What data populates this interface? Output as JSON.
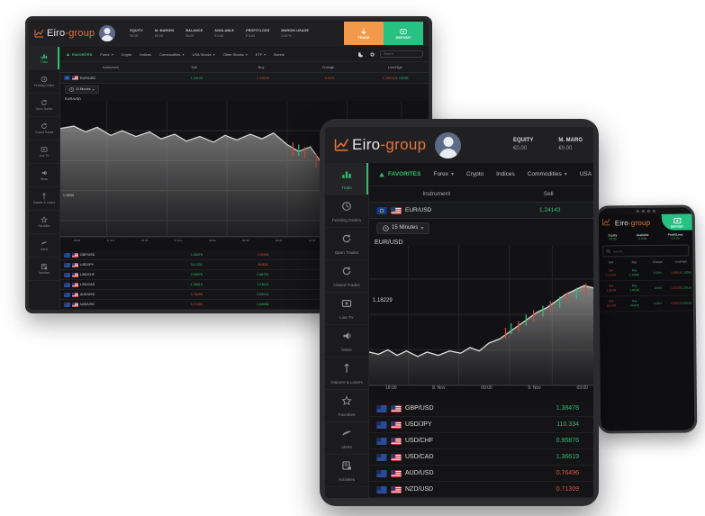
{
  "brand": {
    "name_a": "Eiro",
    "name_b": "-group",
    "logo_icon": "line-chart-icon"
  },
  "desktop": {
    "stats": [
      {
        "label": "EQUITY",
        "value": "€0.00"
      },
      {
        "label": "M. MARGIN",
        "value": "€0.00"
      },
      {
        "label": "BALANCE",
        "value": "€0.00"
      },
      {
        "label": "AVAILABLE",
        "value": "€ 0.00"
      },
      {
        "label": "PROFIT/LOSS",
        "value": "€ 0.00"
      },
      {
        "label": "MARGIN USAGE",
        "value": "0.00 %"
      }
    ],
    "buttons": {
      "trade": "TRADE",
      "deposit": "DEPOSIT"
    },
    "sidebar": [
      {
        "label": "Trade",
        "icon": "chart-icon",
        "active": true
      },
      {
        "label": "Pending Orders",
        "icon": "clock-icon",
        "active": false
      },
      {
        "label": "Open Trades",
        "icon": "refresh-icon",
        "active": false
      },
      {
        "label": "Closed Trades",
        "icon": "refresh-icon",
        "active": false
      },
      {
        "label": "Live TV",
        "icon": "tv-icon",
        "active": false
      },
      {
        "label": "News",
        "icon": "megaphone-icon",
        "active": false
      },
      {
        "label": "Gainers & Losers",
        "icon": "arrows-icon",
        "active": false
      },
      {
        "label": "Favorites",
        "icon": "star-icon",
        "active": false
      },
      {
        "label": "Alerts",
        "icon": "bell-icon",
        "active": false
      },
      {
        "label": "Activities",
        "icon": "list-icon",
        "active": false
      }
    ],
    "nav": [
      {
        "label": "FAVORITES",
        "caret": false,
        "fav": true
      },
      {
        "label": "Forex",
        "caret": true,
        "fav": false
      },
      {
        "label": "Crypto",
        "caret": false,
        "fav": false
      },
      {
        "label": "Indices",
        "caret": false,
        "fav": false
      },
      {
        "label": "Commodities",
        "caret": true,
        "fav": false
      },
      {
        "label": "USA Stocks",
        "caret": true,
        "fav": false
      },
      {
        "label": "Other Stocks",
        "caret": true,
        "fav": false
      },
      {
        "label": "ETF",
        "caret": true,
        "fav": false
      },
      {
        "label": "Bonds",
        "caret": false,
        "fav": false
      }
    ],
    "search": {
      "placeholder": "Search"
    },
    "table": {
      "headers": [
        "Instrument",
        "Sell",
        "Buy",
        "Change",
        "Low/High"
      ],
      "selected": {
        "name": "EUR/USD",
        "sell": "1.24143",
        "buy": "1.13239",
        "change": "-0.01%",
        "low": "1.18014",
        "high": "1.19296"
      },
      "timeframe": "15 Minutes",
      "symbol_label": "EUR/USD",
      "price_tag": "1.18039"
    },
    "chart_axis": [
      "18:00",
      "8. Nov",
      "09:00",
      "9. Nov",
      "03:00",
      "06:00",
      "09:00",
      "12:00",
      "15:00",
      "18:00",
      "21:00"
    ],
    "list": [
      {
        "name": "GBP/USD",
        "sell": "1.38478",
        "buy": "1.25196",
        "change": "0.13%",
        "sell_up": true,
        "buy_up": false,
        "chg_up": true
      },
      {
        "name": "USD/JPY",
        "sell": "110.334",
        "buy": "99.828",
        "change": "-0.03%",
        "sell_up": true,
        "buy_up": false,
        "chg_up": false
      },
      {
        "name": "USD/CHF",
        "sell": "0.95876",
        "buy": "0.86751",
        "change": "0.04%",
        "sell_up": true,
        "buy_up": true,
        "chg_up": true
      },
      {
        "name": "USD/CAD",
        "sell": "1.36619",
        "buy": "1.23613",
        "change": "0.04%",
        "sell_up": true,
        "buy_up": true,
        "chg_up": true
      },
      {
        "name": "AUD/USD",
        "sell": "0.76496",
        "buy": "0.69214",
        "change": "0.11%",
        "sell_up": false,
        "buy_up": true,
        "chg_up": true
      },
      {
        "name": "NZD/USD",
        "sell": "0.71309",
        "buy": "0.64896",
        "change": "0.11%",
        "sell_up": false,
        "buy_up": true,
        "chg_up": true
      }
    ],
    "icons": {
      "dark_mode": "moon-icon",
      "settings": "gear-icon",
      "search": "search-icon"
    }
  },
  "tablet": {
    "stats": [
      {
        "label": "EQUITY",
        "value": "€0.00"
      },
      {
        "label": "M. MARG",
        "value": "€0.00"
      }
    ],
    "sidebar": [
      {
        "label": "Trade",
        "icon": "chart-icon",
        "active": true
      },
      {
        "label": "Pending Orders",
        "icon": "clock-icon",
        "active": false
      },
      {
        "label": "Open Trades",
        "icon": "refresh-icon",
        "active": false
      },
      {
        "label": "Closed Trades",
        "icon": "refresh-icon",
        "active": false
      },
      {
        "label": "Live TV",
        "icon": "tv-icon",
        "active": false
      },
      {
        "label": "News",
        "icon": "megaphone-icon",
        "active": false
      },
      {
        "label": "Gainers & Losers",
        "icon": "arrows-icon",
        "active": false
      },
      {
        "label": "Favorites",
        "icon": "star-icon",
        "active": false
      },
      {
        "label": "Alerts",
        "icon": "bell-icon",
        "active": false
      },
      {
        "label": "Activities",
        "icon": "list-icon",
        "active": false
      }
    ],
    "nav": [
      {
        "label": "FAVORITES",
        "caret": false,
        "fav": true
      },
      {
        "label": "Forex",
        "caret": true,
        "fav": false
      },
      {
        "label": "Crypto",
        "caret": false,
        "fav": false
      },
      {
        "label": "Indices",
        "caret": false,
        "fav": false
      },
      {
        "label": "Commodities",
        "caret": true,
        "fav": false
      },
      {
        "label": "USA Stock",
        "caret": false,
        "fav": false
      }
    ],
    "table": {
      "headers": [
        "Instrument",
        "Sell"
      ],
      "selected": {
        "name": "EUR/USD",
        "sell": "1.24143"
      },
      "timeframe": "15 Minutes",
      "symbol_label": "EUR/USD",
      "price_tag": "1.18229"
    },
    "chart_axis": [
      "18:00",
      "8. Nov",
      "09:00",
      "9. Nov",
      "03:00"
    ],
    "list": [
      {
        "name": "GBP/USD",
        "value": "1.38478",
        "up": true
      },
      {
        "name": "USD/JPY",
        "value": "110.334",
        "up": true
      },
      {
        "name": "USD/CHF",
        "value": "0.95876",
        "up": true
      },
      {
        "name": "USD/CAD",
        "value": "1.36619",
        "up": true
      },
      {
        "name": "AUD/USD",
        "value": "0.76496",
        "up": false
      },
      {
        "name": "NZD/USD",
        "value": "0.71309",
        "up": false
      }
    ]
  },
  "phone": {
    "deposit_label": "DEPOSIT",
    "stats": [
      {
        "label": "Equity",
        "value": "€0.00"
      },
      {
        "label": "Available",
        "value": "€ 0.00"
      },
      {
        "label": "Profit/Loss",
        "value": "€ 0.00"
      }
    ],
    "search": {
      "placeholder": "Search..."
    },
    "headers": [
      "Sell",
      "Buy",
      "Change",
      "Low/High"
    ],
    "rows": [
      {
        "sell": "Sell",
        "sell_v": "1.24143",
        "buy": "Buy",
        "buy_v": "1.13239",
        "change": "0.13%",
        "low": "1.18014",
        "high": "1.19296"
      },
      {
        "sell": "Sell",
        "sell_v": "1.38478",
        "buy": "Buy",
        "buy_v": "1.25196",
        "change": "-0.03%",
        "low": "1.24123",
        "high": "1.26110"
      },
      {
        "sell": "Sell",
        "sell_v": "110.334",
        "buy": "Buy",
        "buy_v": "99.828",
        "change": "0.04%",
        "low": "0.93211",
        "high": "0.96109"
      }
    ]
  },
  "colors": {
    "accent_orange": "#f2994a",
    "accent_green": "#27c281",
    "up": "#2fbf71",
    "down": "#e0503f",
    "panel": "#1b1b1d",
    "screen": "#141416"
  }
}
